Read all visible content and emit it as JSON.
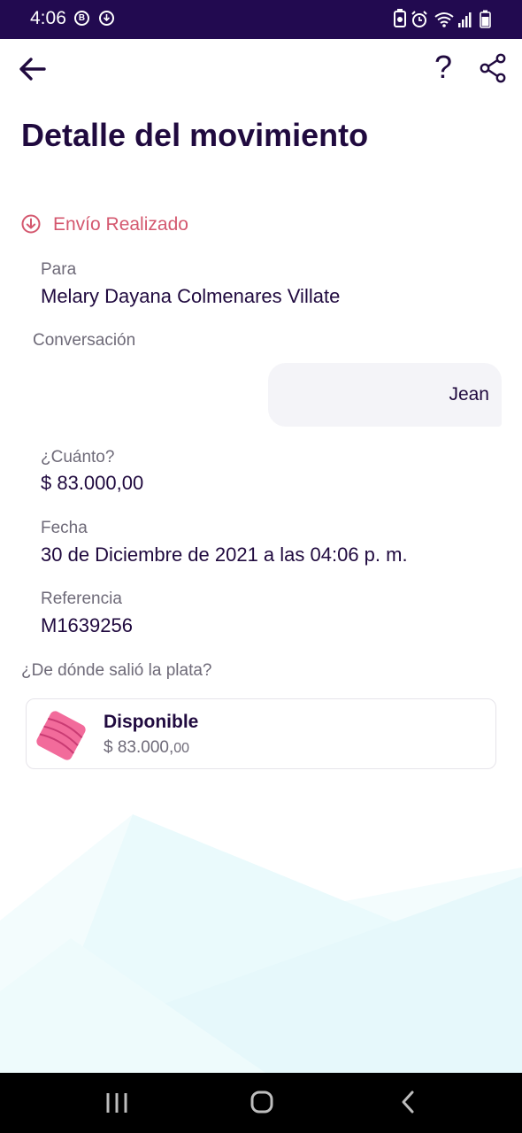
{
  "status_bar": {
    "time": "4:06",
    "left_icons": [
      "b-circle-icon",
      "download-circle-icon"
    ],
    "right_icons": [
      "battery-saver-icon",
      "alarm-icon",
      "wifi-icon",
      "signal-icon",
      "battery-icon"
    ]
  },
  "header": {
    "back_icon": "arrow-left-icon",
    "help_label": "?",
    "share_icon": "share-icon"
  },
  "page_title": "Detalle del movimiento",
  "transaction_status": {
    "icon": "arrow-down-circle-icon",
    "label": "Envío Realizado",
    "color": "#d4586f"
  },
  "recipient": {
    "label": "Para",
    "value": "Melary Dayana Colmenares Villate"
  },
  "conversation": {
    "label": "Conversación",
    "message": "Jean"
  },
  "amount": {
    "label": "¿Cuánto?",
    "value": "$ 83.000,00"
  },
  "date": {
    "label": "Fecha",
    "value": "30 de Diciembre de 2021 a las 04:06 p. m."
  },
  "reference": {
    "label": "Referencia",
    "value": "M1639256"
  },
  "source": {
    "label": "¿De dónde salió la plata?",
    "pocket_name": "Disponible",
    "pocket_amount_main": "$ 83.000,",
    "pocket_amount_cents": "00",
    "pocket_icon": "pink-pocket-icon"
  },
  "nav_bar": {
    "recent_icon": "recent-apps-icon",
    "home_icon": "home-icon",
    "back_icon": "nav-back-icon"
  },
  "colors": {
    "primary": "#200a3f",
    "status_bar": "#220a50",
    "accent_red": "#d4586f",
    "pocket_pink": "#f26b9b"
  }
}
